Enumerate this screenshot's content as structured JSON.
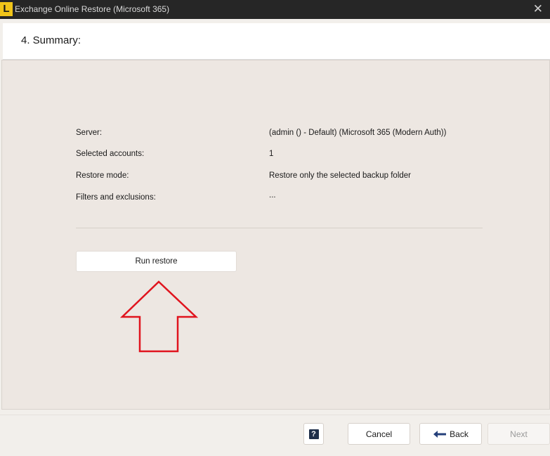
{
  "window": {
    "title": "Exchange Online Restore (Microsoft 365)",
    "icon": "app-logo-icon",
    "close_glyph": "✕"
  },
  "header": {
    "title": "4. Summary:"
  },
  "summary": {
    "rows": [
      {
        "label": "Server:",
        "value": "(admin () - Default) (Microsoft 365 (Modern Auth))"
      },
      {
        "label": "Selected accounts:",
        "value": "1"
      },
      {
        "label": "Restore mode:",
        "value": "Restore only the selected backup folder"
      },
      {
        "label": "Filters and exclusions:",
        "value": "..."
      }
    ],
    "run_button_label": "Run restore"
  },
  "annotation": {
    "icon": "arrow-up-icon",
    "color": "#e0141e"
  },
  "footer": {
    "help_glyph": "?",
    "cancel_label": "Cancel",
    "back_label": "Back",
    "next_label": "Next"
  },
  "colors": {
    "titlebar": "#262626",
    "panel": "#ede7e2",
    "arrow": "#e0141e",
    "back_arrow": "#24407a"
  }
}
